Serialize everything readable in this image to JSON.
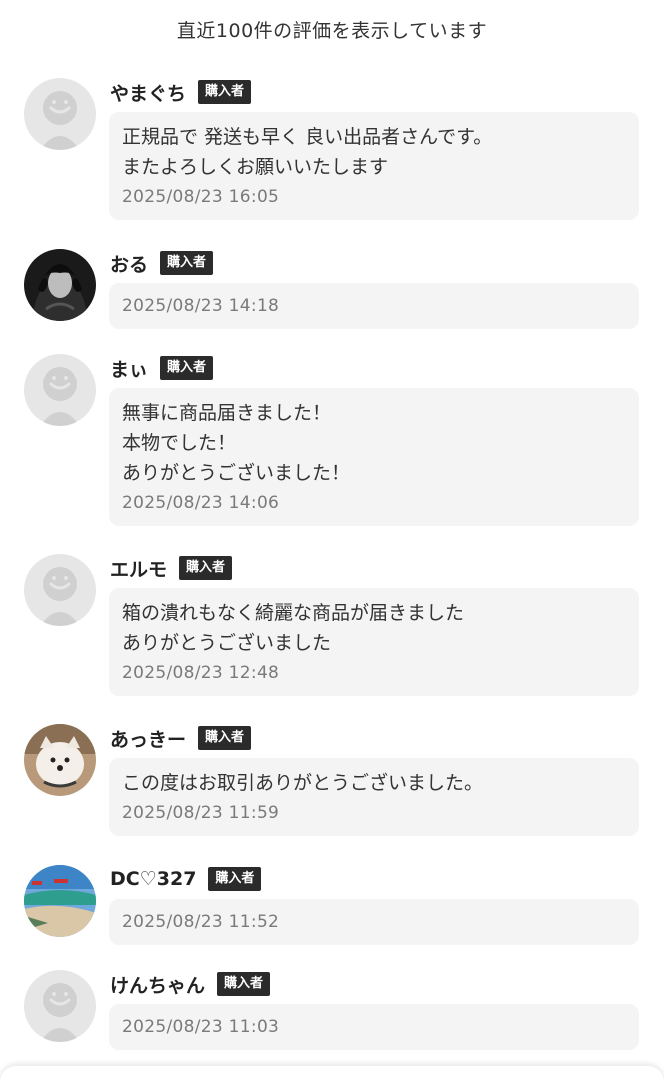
{
  "header": {
    "text": "直近100件の評価を表示しています"
  },
  "badge_label": "購入者",
  "reviews": [
    {
      "name": "やまぐち",
      "comment": "正規品で 発送も早く 良い出品者さんです。\nまたよろしくお願いいたします",
      "date": "2025/08/23 16:05",
      "avatar": "default-avatar"
    },
    {
      "name": "おる",
      "comment": "",
      "date": "2025/08/23 14:18",
      "avatar": "anime-character-avatar"
    },
    {
      "name": "まぃ",
      "comment": "無事に商品届きました！\n本物でした！\nありがとうございました！",
      "date": "2025/08/23 14:06",
      "avatar": "default-avatar"
    },
    {
      "name": "エルモ",
      "comment": "箱の潰れもなく綺麗な商品が届きました\nありがとうございました",
      "date": "2025/08/23 12:48",
      "avatar": "default-avatar"
    },
    {
      "name": "あっきー",
      "comment": "この度はお取引ありがとうございました。",
      "date": "2025/08/23 11:59",
      "avatar": "dog-photo-avatar"
    },
    {
      "name": "DC♡327",
      "comment": "",
      "date": "2025/08/23 11:52",
      "avatar": "beach-photo-avatar"
    },
    {
      "name": "けんちゃん",
      "comment": "",
      "date": "2025/08/23 11:03",
      "avatar": "default-avatar"
    }
  ]
}
